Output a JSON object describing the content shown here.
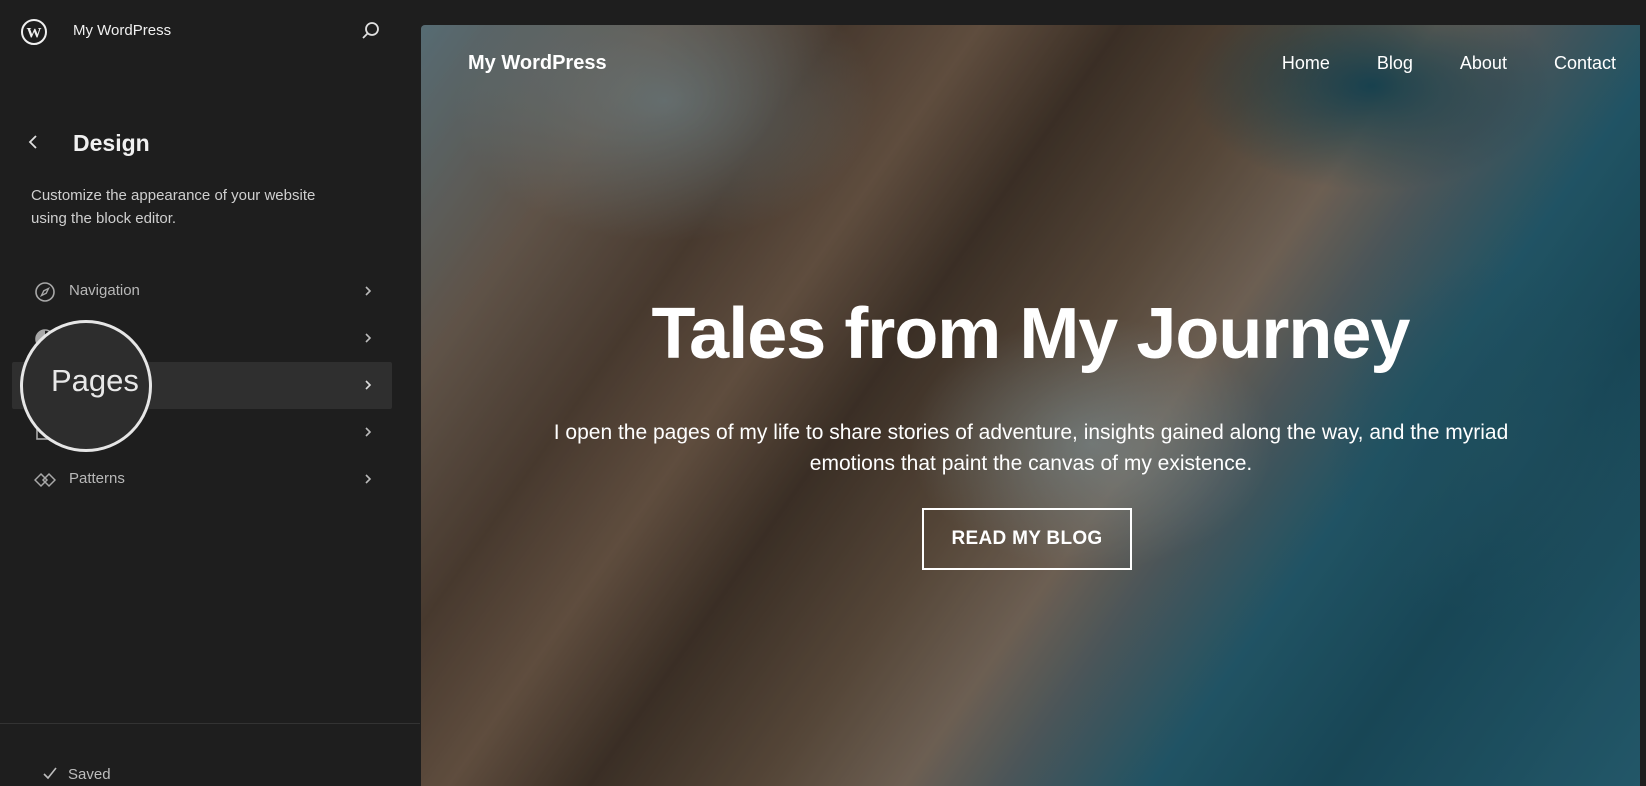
{
  "sidebar": {
    "site_name": "My WordPress",
    "design_title": "Design",
    "design_description": "Customize the appearance of your website using the block editor.",
    "items": [
      {
        "label": "Navigation",
        "icon": "navigation-compass-icon"
      },
      {
        "label": "",
        "icon": "styles-icon"
      },
      {
        "label": "",
        "icon": "pages-icon"
      },
      {
        "label": "",
        "icon": "templates-icon"
      },
      {
        "label": "Patterns",
        "icon": "patterns-icon"
      }
    ],
    "active_index": 2,
    "saved_label": "Saved"
  },
  "magnifier": {
    "text": "Pages"
  },
  "preview": {
    "site_title": "My WordPress",
    "nav": [
      "Home",
      "Blog",
      "About",
      "Contact"
    ],
    "hero_title": "Tales from My Journey",
    "hero_subtitle": "I open the pages of my life to share stories of adventure, insights gained along the way, and the myriad emotions that paint the canvas of my existence.",
    "cta_label": "READ MY BLOG"
  }
}
